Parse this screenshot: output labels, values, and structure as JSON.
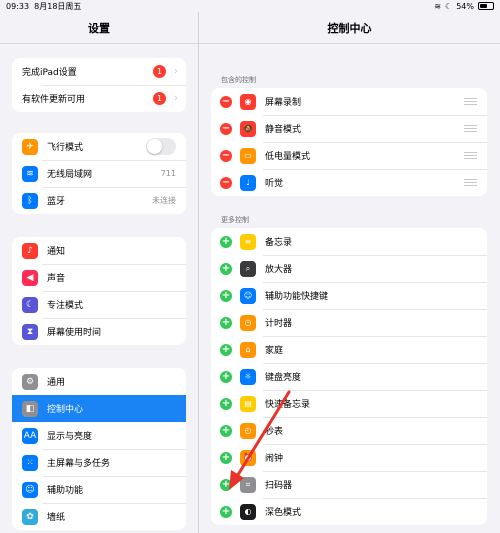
{
  "status": {
    "time": "09:33",
    "date": "8月18日周五",
    "battery": "54%",
    "battery_level": 0.54
  },
  "left": {
    "title": "设置",
    "group1": [
      {
        "label": "完成iPad设置",
        "badge": "1",
        "icon": ""
      },
      {
        "label": "有软件更新可用",
        "badge": "1",
        "icon": ""
      }
    ],
    "group2": [
      {
        "label": "飞行模式",
        "icon": "airplane-icon",
        "color": "#ff9500",
        "glyph": "✈"
      },
      {
        "label": "无线局域网",
        "value": "711",
        "icon": "wifi-icon",
        "color": "#007aff",
        "glyph": "≋"
      },
      {
        "label": "蓝牙",
        "value": "未连接",
        "icon": "bluetooth-icon",
        "color": "#007aff",
        "glyph": "ᛒ"
      }
    ],
    "group3": [
      {
        "label": "通知",
        "icon": "bell-icon",
        "color": "#ff3b30",
        "glyph": "♪"
      },
      {
        "label": "声音",
        "icon": "speaker-icon",
        "color": "#ff2d55",
        "glyph": "◀"
      },
      {
        "label": "专注模式",
        "icon": "moon-icon",
        "color": "#5856d6",
        "glyph": "☾"
      },
      {
        "label": "屏幕使用时间",
        "icon": "hourglass-icon",
        "color": "#5856d6",
        "glyph": "⧗"
      }
    ],
    "group4": [
      {
        "label": "通用",
        "icon": "gear-icon",
        "color": "#8e8e93",
        "glyph": "⚙"
      },
      {
        "label": "控制中心",
        "icon": "switches-icon",
        "color": "#8e8e93",
        "glyph": "◧"
      },
      {
        "label": "显示与亮度",
        "icon": "aa-icon",
        "color": "#007aff",
        "glyph": "AA"
      },
      {
        "label": "主屏幕与多任务",
        "icon": "grid-icon",
        "color": "#007aff",
        "glyph": "⁙"
      },
      {
        "label": "辅助功能",
        "icon": "accessibility-icon",
        "color": "#007aff",
        "glyph": "☺"
      },
      {
        "label": "墙纸",
        "icon": "flower-icon",
        "color": "#34aadc",
        "glyph": "✿"
      }
    ]
  },
  "right": {
    "title": "控制中心",
    "included_header": "包含的控制",
    "included": [
      {
        "label": "屏幕录制",
        "icon": "record-icon",
        "color": "#ff3b30",
        "glyph": "◉"
      },
      {
        "label": "静音模式",
        "icon": "bell-slash-icon",
        "color": "#ff3b30",
        "glyph": "🔕"
      },
      {
        "label": "低电量模式",
        "icon": "battery-icon",
        "color": "#ff9500",
        "glyph": "▭"
      },
      {
        "label": "听觉",
        "icon": "ear-icon",
        "color": "#007aff",
        "glyph": "♩"
      }
    ],
    "more_header": "更多控制",
    "more": [
      {
        "label": "备忘录",
        "icon": "notes-icon",
        "color": "#ffcc00",
        "glyph": "≡"
      },
      {
        "label": "放大器",
        "icon": "magnifier-icon",
        "color": "#3a3a3c",
        "glyph": "⌕"
      },
      {
        "label": "辅助功能快捷键",
        "icon": "accessibility-shortcut-icon",
        "color": "#007aff",
        "glyph": "☺"
      },
      {
        "label": "计时器",
        "icon": "timer-icon",
        "color": "#ff9500",
        "glyph": "◷"
      },
      {
        "label": "家庭",
        "icon": "home-icon",
        "color": "#ff9500",
        "glyph": "⌂"
      },
      {
        "label": "键盘亮度",
        "icon": "keyboard-brightness-icon",
        "color": "#007aff",
        "glyph": "☼"
      },
      {
        "label": "快速备忘录",
        "icon": "quick-note-icon",
        "color": "#ffcc00",
        "glyph": "▤"
      },
      {
        "label": "秒表",
        "icon": "stopwatch-icon",
        "color": "#ff9500",
        "glyph": "◴"
      },
      {
        "label": "闹钟",
        "icon": "alarm-icon",
        "color": "#ff9500",
        "glyph": "⏰"
      },
      {
        "label": "扫码器",
        "icon": "qr-scanner-icon",
        "color": "#8e8e93",
        "glyph": "⌗"
      },
      {
        "label": "深色模式",
        "icon": "dark-mode-icon",
        "color": "#1c1c1e",
        "glyph": "◐"
      }
    ]
  },
  "colors": {
    "accent": "#1a84f5",
    "annotation_arrow": "#e8322b"
  }
}
